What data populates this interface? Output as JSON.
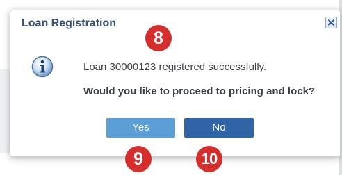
{
  "dialog": {
    "title": "Loan Registration",
    "close_icon": "close-icon",
    "info_icon": "info-icon",
    "message": "Loan 30000123 registered successfully.",
    "question": "Would you like to proceed to pricing and lock?",
    "buttons": {
      "yes_label": "Yes",
      "no_label": "No"
    }
  },
  "callouts": {
    "message_marker": "8",
    "yes_marker": "9",
    "no_marker": "10"
  },
  "colors": {
    "title": "#35506e",
    "yes_button": "#5b9fd6",
    "no_button": "#2f64a6",
    "callout": "#d42f2c"
  }
}
